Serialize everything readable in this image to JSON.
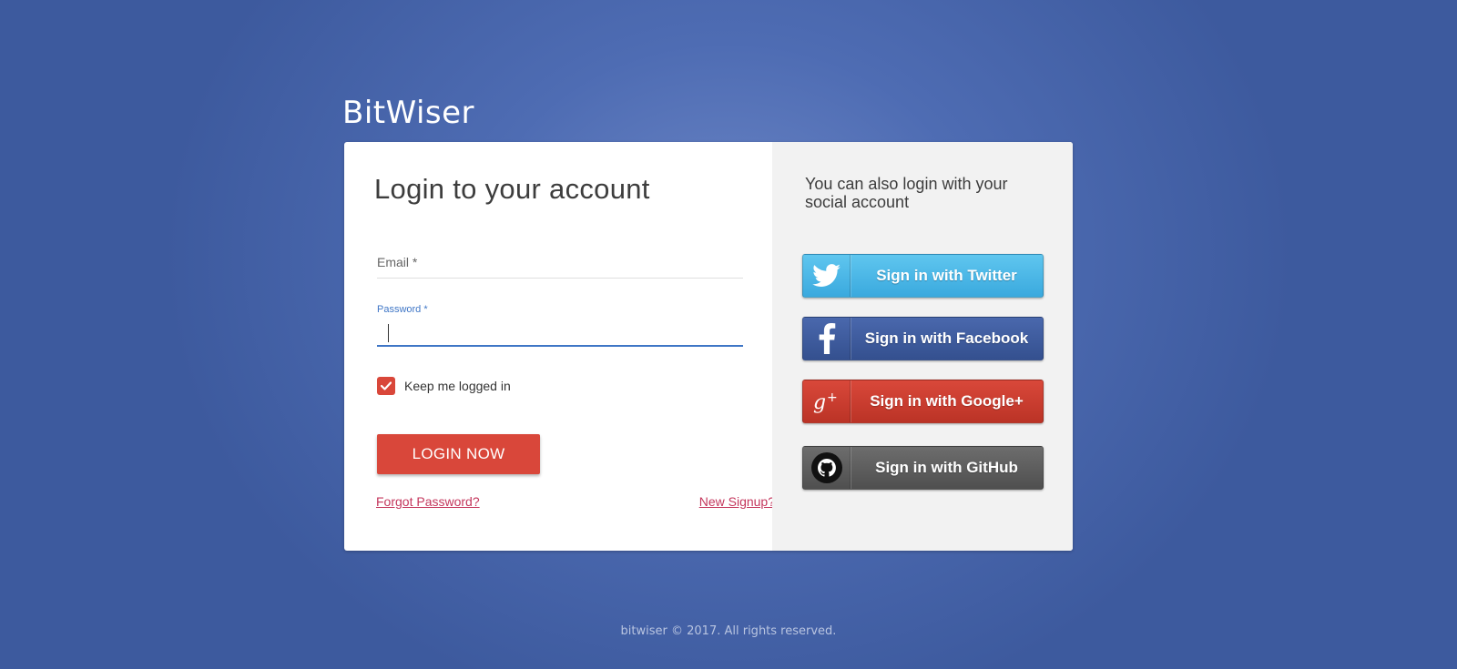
{
  "brand": {
    "name": "BitWiser"
  },
  "login": {
    "title": "Login to your account",
    "email_label": "Email *",
    "password_label": "Password *",
    "password_value": "",
    "keep_logged_in_label": "Keep me logged in",
    "keep_logged_in_checked": true,
    "login_button": "LOGIN NOW",
    "forgot_password": "Forgot Password?",
    "new_signup": "New Signup?"
  },
  "social": {
    "intro": "You can also login with your social account",
    "buttons": [
      {
        "label": "Sign in with Twitter",
        "icon": "twitter-icon",
        "color": "#4bb8e8"
      },
      {
        "label": "Sign in with Facebook",
        "icon": "facebook-icon",
        "color": "#3b5998"
      },
      {
        "label": "Sign in with Google+",
        "icon": "google-plus-icon",
        "color": "#d13c2f"
      },
      {
        "label": "Sign in with GitHub",
        "icon": "github-icon",
        "color": "#5e5e5e"
      }
    ]
  },
  "footer": {
    "text": "bitwiser © 2017. All rights reserved."
  },
  "colors": {
    "accent": "#d9473a",
    "link": "#c4365c",
    "focus": "#3f76c6",
    "background": "#4e6cb3"
  }
}
